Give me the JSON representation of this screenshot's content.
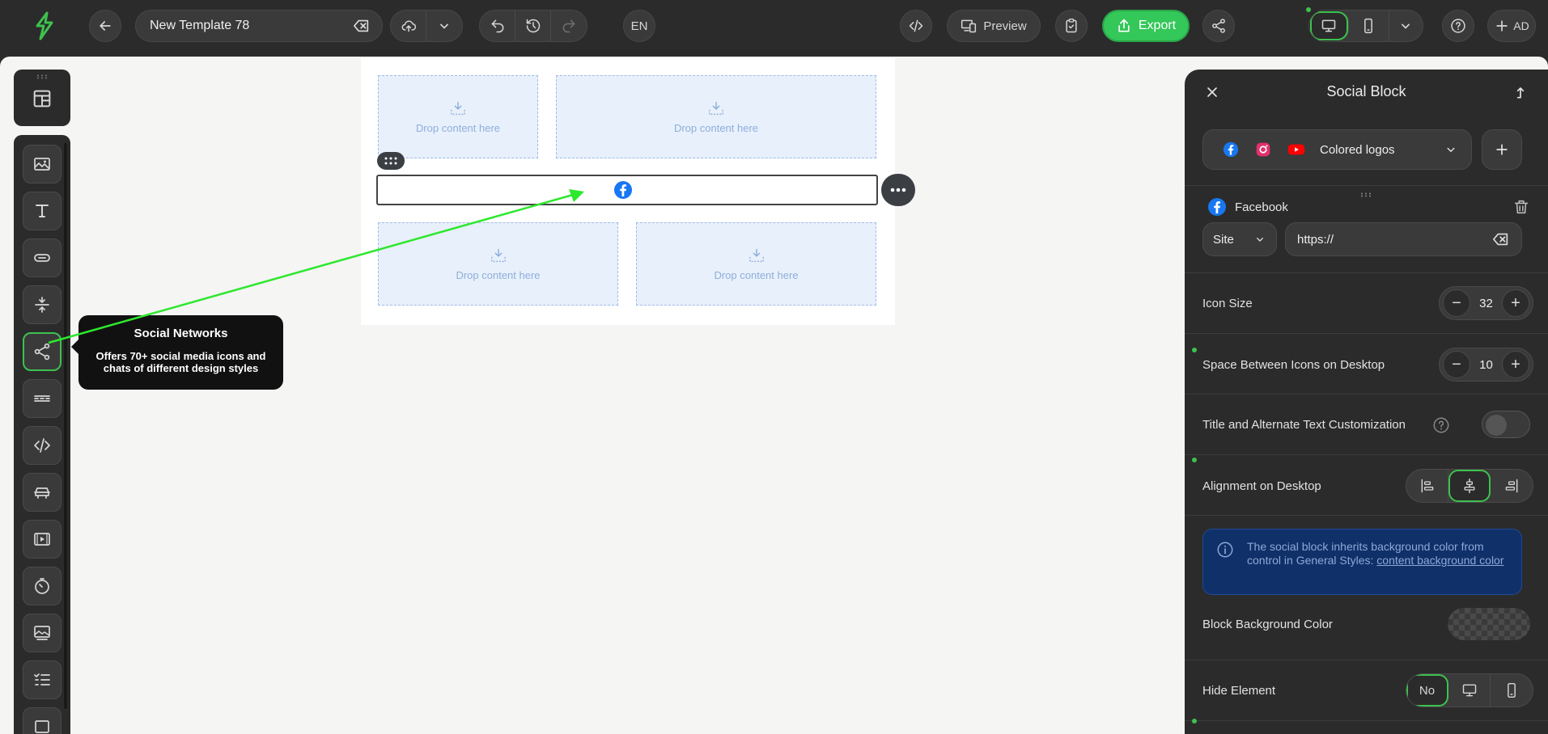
{
  "topbar": {
    "template_name": "New Template 78",
    "language": "EN",
    "preview_label": "Preview",
    "export_label": "Export",
    "user_initials": "AD"
  },
  "canvas": {
    "drop_label": "Drop content here"
  },
  "tooltip": {
    "title": "Social Networks",
    "text": "Offers 70+ social media icons and chats of different design styles"
  },
  "panel": {
    "title": "Social Block",
    "style_select": "Colored logos",
    "network": {
      "name": "Facebook",
      "link_type": "Site",
      "url": "https://"
    },
    "icon_size": {
      "label": "Icon Size",
      "value": "32"
    },
    "spacing": {
      "label": "Space Between Icons on Desktop",
      "value": "10"
    },
    "title_alt": {
      "label": "Title and Alternate Text Customization"
    },
    "alignment": {
      "label": "Alignment on Desktop"
    },
    "info": {
      "text": "The social block inherits background color from control in General Styles: ",
      "link": "content background color"
    },
    "bg_color": {
      "label": "Block Background Color"
    },
    "hide": {
      "label": "Hide Element",
      "no_label": "No"
    }
  },
  "colors": {
    "accent": "#3ec14f",
    "facebook": "#1877f2",
    "instagram": "#e1306c",
    "youtube": "#ff0000",
    "annotation_arrow": "#2ee82e"
  }
}
